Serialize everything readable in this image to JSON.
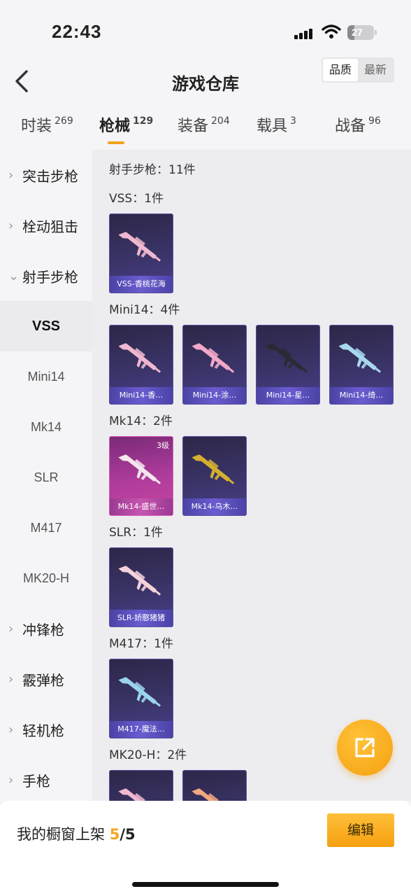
{
  "status_bar": {
    "time": "22:43",
    "battery": "27",
    "battery_level": 0.27
  },
  "header": {
    "title": "游戏仓库",
    "sort_options": [
      "品质",
      "最新"
    ],
    "sort_active": "品质"
  },
  "tabs": [
    {
      "label": "时装",
      "count": "269"
    },
    {
      "label": "枪械",
      "count": "129",
      "active": true
    },
    {
      "label": "装备",
      "count": "204"
    },
    {
      "label": "载具",
      "count": "3"
    },
    {
      "label": "战备",
      "count": "96"
    }
  ],
  "sidebar": [
    {
      "label": "突击步枪",
      "type": "parent",
      "chevron": "›"
    },
    {
      "label": "栓动狙击",
      "type": "parent",
      "chevron": "›"
    },
    {
      "label": "射手步枪",
      "type": "parent",
      "chevron": "⌄"
    },
    {
      "label": "VSS",
      "type": "child",
      "selected": true
    },
    {
      "label": "Mini14",
      "type": "child"
    },
    {
      "label": "Mk14",
      "type": "child"
    },
    {
      "label": "SLR",
      "type": "child"
    },
    {
      "label": "M417",
      "type": "child"
    },
    {
      "label": "MK20-H",
      "type": "child"
    },
    {
      "label": "冲锋枪",
      "type": "parent",
      "chevron": "›"
    },
    {
      "label": "霰弹枪",
      "type": "parent",
      "chevron": "›"
    },
    {
      "label": "轻机枪",
      "type": "parent",
      "chevron": "›"
    },
    {
      "label": "手枪",
      "type": "parent",
      "chevron": "›"
    }
  ],
  "content": {
    "category_total": "射手步枪：11件",
    "sections": [
      {
        "label": "VSS：1件",
        "items": [
          {
            "name": "VSS-香桃花海",
            "tint": "#f0b8d0"
          }
        ]
      },
      {
        "label": "Mini14：4件",
        "items": [
          {
            "name": "Mini14-香…",
            "tint": "#f0b8d0"
          },
          {
            "name": "Mini14-涂…",
            "tint": "#f2a8c8"
          },
          {
            "name": "Mini14-星…",
            "tint": "#2a2a36"
          },
          {
            "name": "Mini14-绮…",
            "tint": "#a8d8ee"
          }
        ]
      },
      {
        "label": "Mk14：2件",
        "items": [
          {
            "name": "Mk14-盛世…",
            "tint": "#f4e6ee",
            "level": "3级",
            "pink": true
          },
          {
            "name": "Mk14-乌木…",
            "tint": "#d4b030"
          }
        ]
      },
      {
        "label": "SLR：1件",
        "items": [
          {
            "name": "SLR-娇憨猪猪",
            "tint": "#f4d2da"
          }
        ]
      },
      {
        "label": "M417：1件",
        "items": [
          {
            "name": "M417-魔法…",
            "tint": "#9ad4ec"
          }
        ]
      },
      {
        "label": "MK20-H：2件",
        "items": [
          {
            "name": "",
            "tint": "#f0b8d0"
          },
          {
            "name": "",
            "tint": "#f2a880"
          }
        ]
      }
    ]
  },
  "fab": {
    "icon": "share-export-icon"
  },
  "bottom": {
    "shelf_label": "我的橱窗上架",
    "shelf_used": "5",
    "shelf_total": "/5",
    "edit_label": "编辑"
  },
  "colors": {
    "accent": "#f5a623",
    "card_bg": "#3a3468",
    "card_caption": "#6a5cd0"
  }
}
